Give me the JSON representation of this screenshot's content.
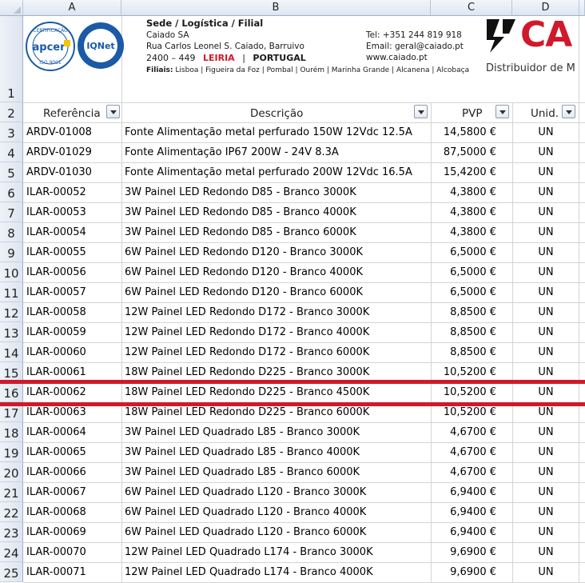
{
  "columns": [
    "A",
    "B",
    "C",
    "D"
  ],
  "letterhead": {
    "cert1_top": "CERTIFICAÇÃO",
    "cert1_brand": "apcer",
    "cert1_bottom": "ISO 9001",
    "cert2_brand": "IQNet",
    "cert2_ring": "CERTIFIED MANAGEMENT SYSTEM",
    "title": "Sede / Logística / Filial",
    "company": "Caiado SA",
    "address": "Rua Carlos Leonel S. Caiado, Barruivo",
    "postal": "2400 – 449",
    "city": "LEIRIA",
    "separator": "|",
    "country": "PORTUGAL",
    "branches_label": "Filiais:",
    "branches": "Lisboa | Figueira da Foz | Pombal | Ourém | Marinha Grande | Alcanena | Alcobaça",
    "tel": "Tel: +351 244 819 918",
    "email": "Email: geral@caiado.pt",
    "web": "www.caiado.pt",
    "logo_text": "CA",
    "tagline": "Distribuidor de M"
  },
  "headers": {
    "ref": "Referência",
    "desc": "Descrição",
    "pvp": "PVP",
    "unid": "Unid."
  },
  "rows": [
    {
      "n": "3",
      "ref": "ARDV-01008",
      "desc": "Fonte Alimentação metal perfurado 150W 12Vdc 12.5A",
      "pvp": "14,5800 €",
      "unid": "UN"
    },
    {
      "n": "4",
      "ref": "ARDV-01029",
      "desc": "Fonte Alimentação IP67 200W - 24V 8.3A",
      "pvp": "87,5000 €",
      "unid": "UN"
    },
    {
      "n": "5",
      "ref": "ARDV-01030",
      "desc": "Fonte Alimentação metal perfurado 200W 12Vdc 16.5A",
      "pvp": "15,4200 €",
      "unid": "UN"
    },
    {
      "n": "6",
      "ref": "ILAR-00052",
      "desc": "3W Painel LED Redondo D85 - Branco 3000K",
      "pvp": "4,3800 €",
      "unid": "UN"
    },
    {
      "n": "7",
      "ref": "ILAR-00053",
      "desc": "3W Painel LED Redondo D85 - Branco 4000K",
      "pvp": "4,3800 €",
      "unid": "UN"
    },
    {
      "n": "8",
      "ref": "ILAR-00054",
      "desc": "3W Painel LED Redondo D85 - Branco 6000K",
      "pvp": "4,3800 €",
      "unid": "UN"
    },
    {
      "n": "9",
      "ref": "ILAR-00055",
      "desc": "6W Painel LED Redondo D120 - Branco 3000K",
      "pvp": "6,5000 €",
      "unid": "UN"
    },
    {
      "n": "10",
      "ref": "ILAR-00056",
      "desc": "6W Painel LED Redondo D120 - Branco 4000K",
      "pvp": "6,5000 €",
      "unid": "UN"
    },
    {
      "n": "11",
      "ref": "ILAR-00057",
      "desc": "6W Painel LED Redondo D120 - Branco 6000K",
      "pvp": "6,5000 €",
      "unid": "UN"
    },
    {
      "n": "12",
      "ref": "ILAR-00058",
      "desc": "12W Painel LED Redondo D172 - Branco 3000K",
      "pvp": "8,8500 €",
      "unid": "UN"
    },
    {
      "n": "13",
      "ref": "ILAR-00059",
      "desc": "12W Painel LED Redondo D172 - Branco 4000K",
      "pvp": "8,8500 €",
      "unid": "UN"
    },
    {
      "n": "14",
      "ref": "ILAR-00060",
      "desc": "12W Painel LED Redondo D172 - Branco 6000K",
      "pvp": "8,8500 €",
      "unid": "UN"
    },
    {
      "n": "15",
      "ref": "ILAR-00061",
      "desc": "18W Painel LED Redondo D225 - Branco 3000K",
      "pvp": "10,5200 €",
      "unid": "UN"
    },
    {
      "n": "16",
      "ref": "ILAR-00062",
      "desc": "18W Painel LED Redondo D225 - Branco 4500K",
      "pvp": "10,5200 €",
      "unid": "UN"
    },
    {
      "n": "17",
      "ref": "ILAR-00063",
      "desc": "18W Painel LED Redondo D225 - Branco 6000K",
      "pvp": "10,5200 €",
      "unid": "UN"
    },
    {
      "n": "18",
      "ref": "ILAR-00064",
      "desc": "3W Painel LED Quadrado L85 - Branco 3000K",
      "pvp": "4,6700 €",
      "unid": "UN"
    },
    {
      "n": "19",
      "ref": "ILAR-00065",
      "desc": "3W Painel LED Quadrado L85 - Branco 4000K",
      "pvp": "4,6700 €",
      "unid": "UN"
    },
    {
      "n": "20",
      "ref": "ILAR-00066",
      "desc": "3W Painel LED Quadrado L85 - Branco 6000K",
      "pvp": "4,6700 €",
      "unid": "UN"
    },
    {
      "n": "21",
      "ref": "ILAR-00067",
      "desc": "6W Painel LED Quadrado L120 - Branco 3000K",
      "pvp": "6,9400 €",
      "unid": "UN"
    },
    {
      "n": "22",
      "ref": "ILAR-00068",
      "desc": "6W Painel LED Quadrado L120 - Branco 4000K",
      "pvp": "6,9400 €",
      "unid": "UN"
    },
    {
      "n": "23",
      "ref": "ILAR-00069",
      "desc": "6W Painel LED Quadrado L120 - Branco 6000K",
      "pvp": "6,9400 €",
      "unid": "UN"
    },
    {
      "n": "24",
      "ref": "ILAR-00070",
      "desc": "12W Painel LED Quadrado L174 - Branco 3000K",
      "pvp": "9,6900 €",
      "unid": "UN"
    },
    {
      "n": "25",
      "ref": "ILAR-00071",
      "desc": "12W Painel LED Quadrado L174 - Branco 4000K",
      "pvp": "9,6900 €",
      "unid": "UN"
    }
  ],
  "row_labels_top": [
    "1",
    "2"
  ],
  "colors": {
    "annotation_red": "#d0192a",
    "header_blue": "#dde5f0",
    "brand_red": "#d0192a",
    "apcer_blue": "#1a5aa6"
  }
}
